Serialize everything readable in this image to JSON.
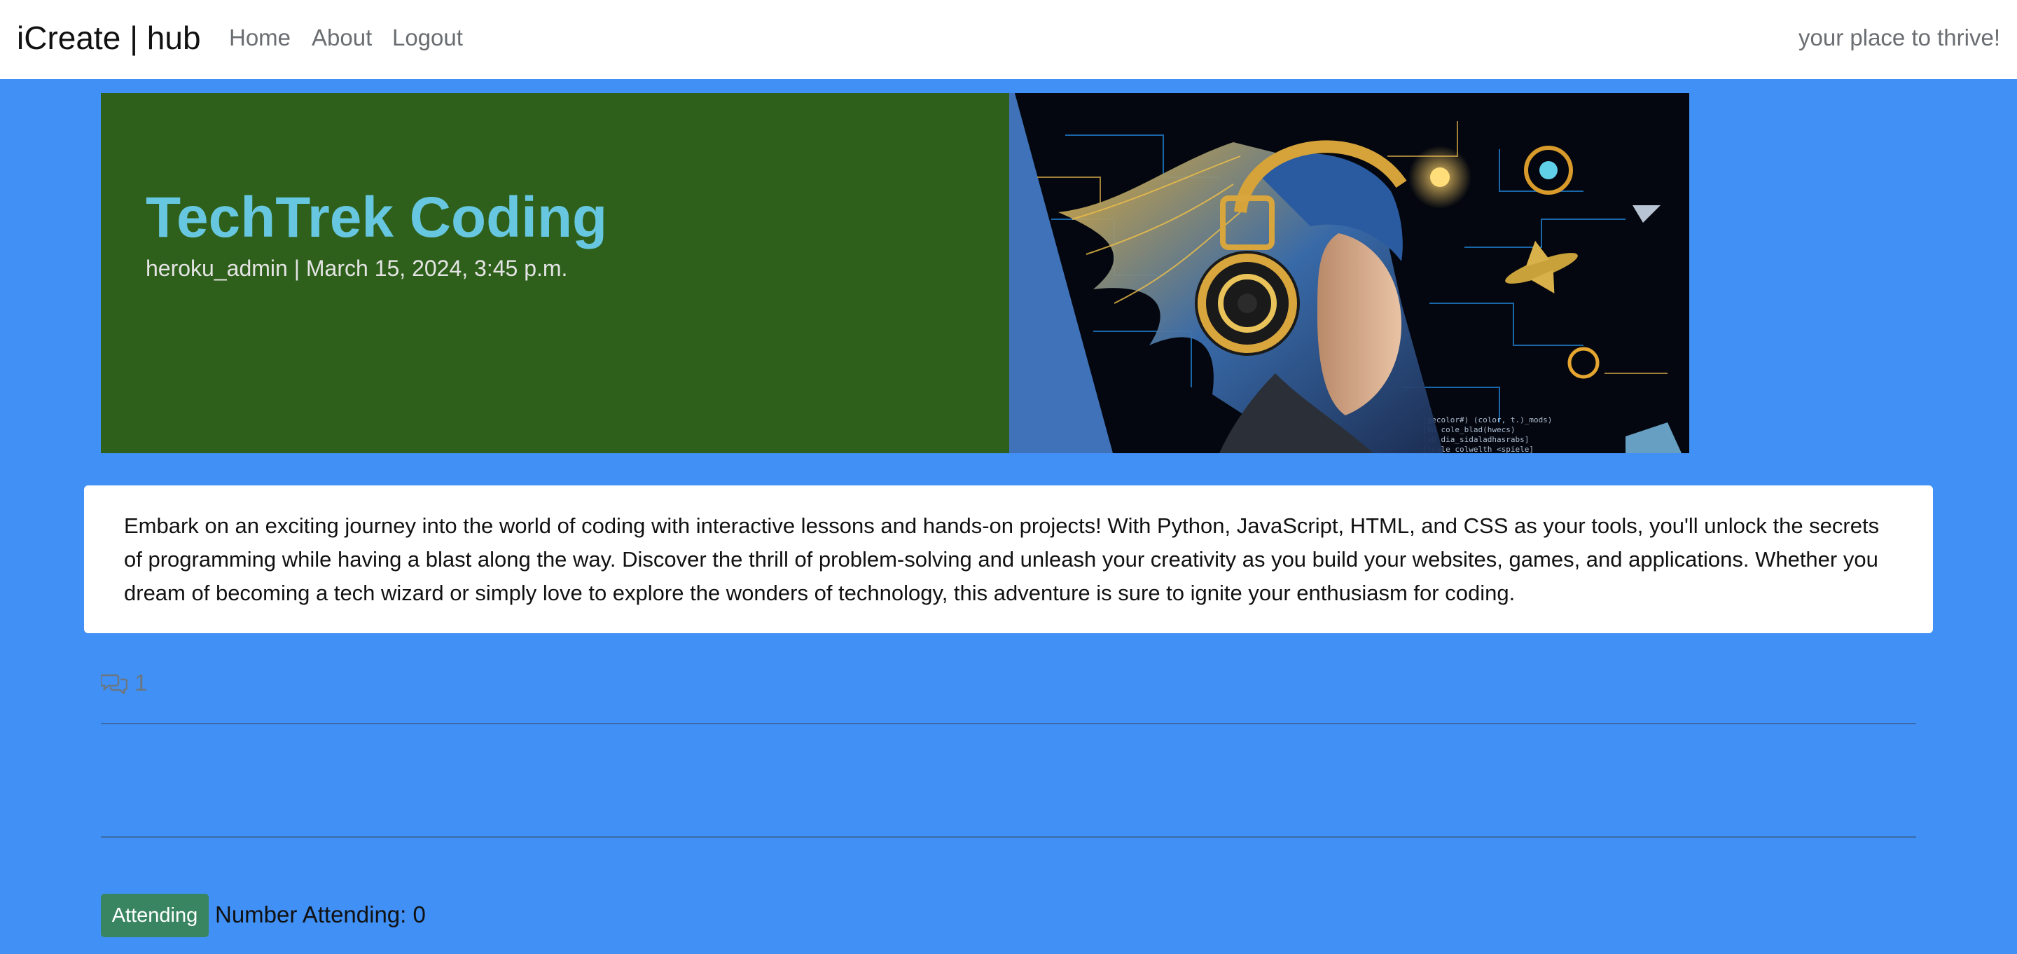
{
  "navbar": {
    "brand": "iCreate | hub",
    "links": [
      {
        "label": "Home"
      },
      {
        "label": "About"
      },
      {
        "label": "Logout"
      }
    ],
    "tagline": "your place to thrive!"
  },
  "event": {
    "title": "TechTrek Coding",
    "meta": "heroku_admin | March 15, 2024, 3:45 p.m.",
    "image_icon": "coding-girl-headphones-illustration",
    "description": "Embark on an exciting journey into the world of coding with interactive lessons and hands-on projects! With Python, JavaScript, HTML, and CSS as your tools, you'll unlock the secrets of programming while having a blast along the way. Discover the thrill of problem-solving and unleash your creativity as you build your websites, games, and applications. Whether you dream of becoming a tech wizard or simply love to explore the wonders of technology, this adventure is sure to ignite your enthusiasm for coding."
  },
  "comments": {
    "icon": "comments-icon",
    "count": "1"
  },
  "attendance": {
    "button_label": "Attending",
    "count_text": "Number Attending: 0"
  },
  "colors": {
    "page_bg": "#4090f5",
    "hero_left_bg": "#2e601b",
    "title_color": "#68c7e0",
    "attend_button": "#3a8561"
  }
}
